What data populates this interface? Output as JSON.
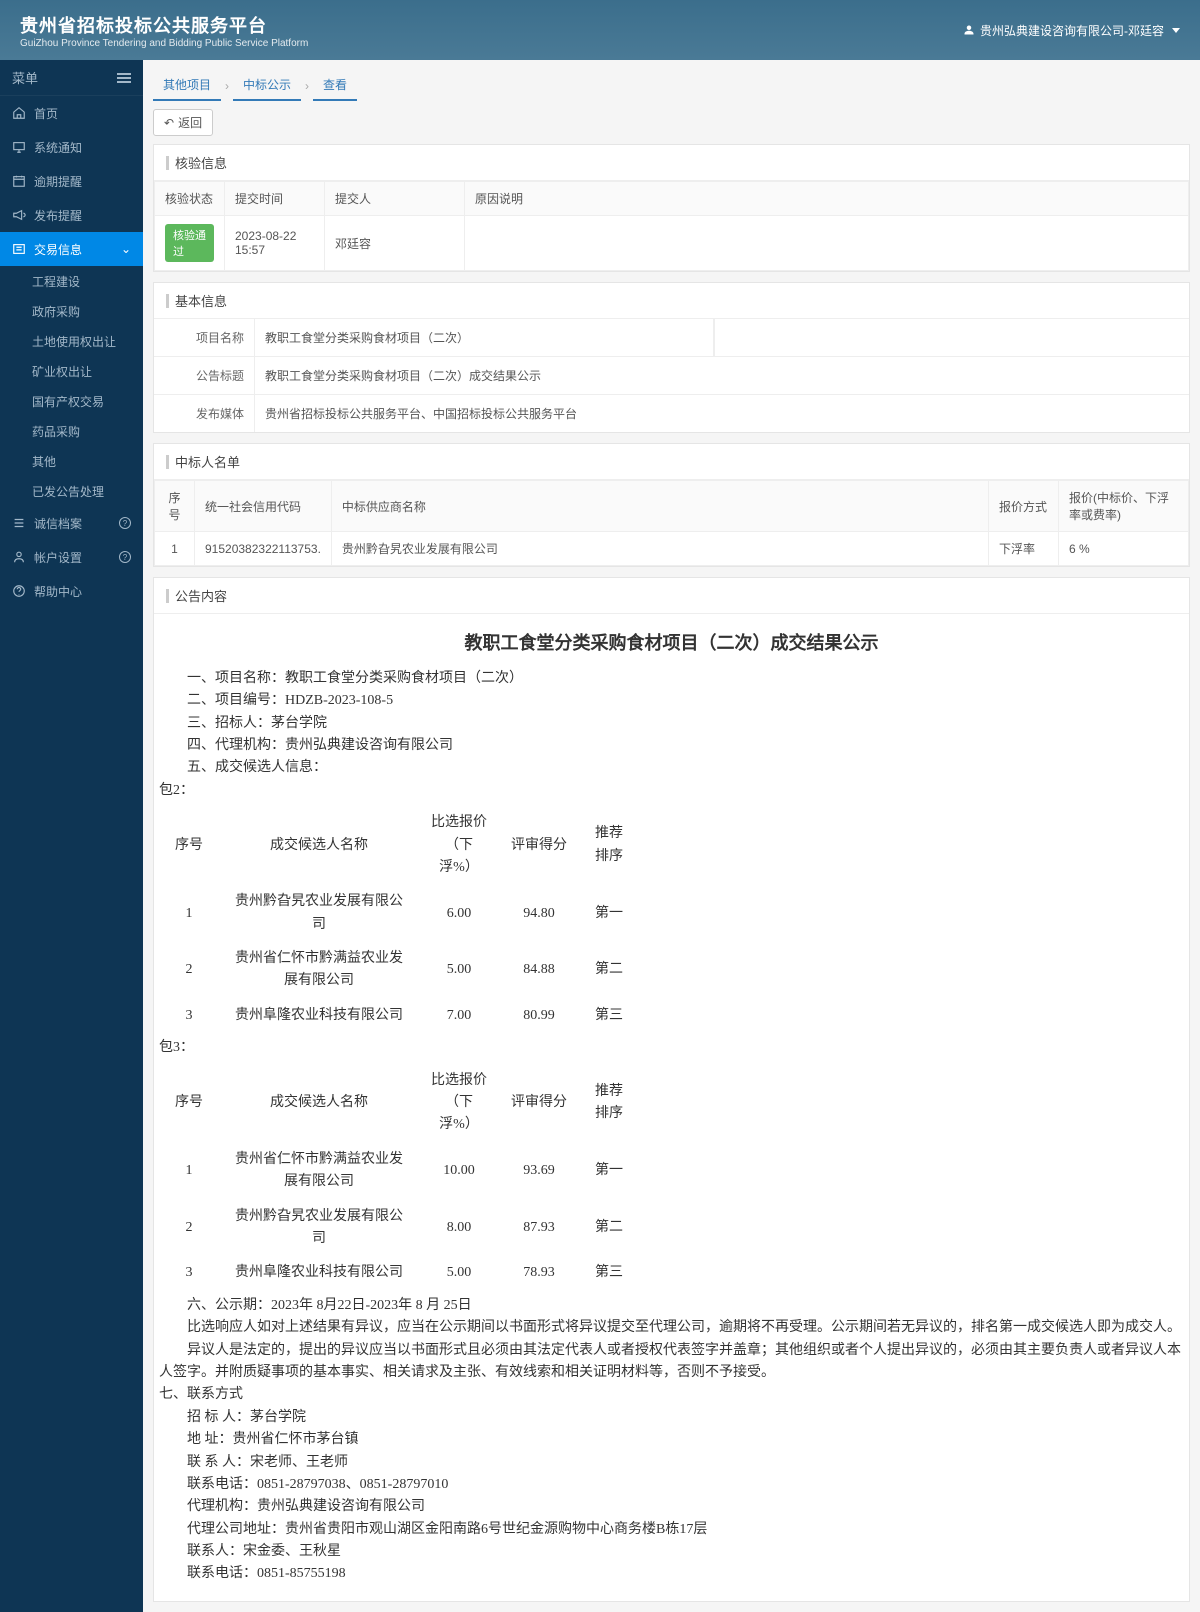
{
  "header": {
    "title": "贵州省招标投标公共服务平台",
    "subtitle": "GuiZhou Province Tendering and Bidding Public Service Platform",
    "user": "贵州弘典建设咨询有限公司-邓廷容"
  },
  "sidebar": {
    "menu_label": "菜单",
    "items": [
      {
        "icon": "home",
        "label": "首页"
      },
      {
        "icon": "monitor",
        "label": "系统通知"
      },
      {
        "icon": "calendar",
        "label": "逾期提醒"
      },
      {
        "icon": "megaphone",
        "label": "发布提醒"
      },
      {
        "icon": "folder",
        "label": "交易信息",
        "active": true,
        "expand": true
      }
    ],
    "sub_items": [
      "工程建设",
      "政府采购",
      "土地使用权出让",
      "矿业权出让",
      "国有产权交易",
      "药品采购",
      "其他",
      "已发公告处理"
    ],
    "tail_items": [
      {
        "icon": "list",
        "label": "诚信档案",
        "badge": true
      },
      {
        "icon": "user",
        "label": "帐户设置",
        "badge": true
      },
      {
        "icon": "help",
        "label": "帮助中心"
      }
    ]
  },
  "breadcrumb": {
    "items": [
      "其他项目",
      "中标公示",
      "查看"
    ]
  },
  "back_label": "返回",
  "verify_panel": {
    "title": "核验信息",
    "headers": [
      "核验状态",
      "提交时间",
      "提交人",
      "原因说明"
    ],
    "row": {
      "status": "核验通过",
      "time": "2023-08-22 15:57",
      "submitter": "邓廷容",
      "reason": ""
    }
  },
  "basic_panel": {
    "title": "基本信息",
    "rows": [
      {
        "label": "项目名称",
        "value": "教职工食堂分类采购食材项目（二次）",
        "boxed": true
      },
      {
        "label": "公告标题",
        "value": "教职工食堂分类采购食材项目（二次）成交结果公示"
      },
      {
        "label": "发布媒体",
        "value": "贵州省招标投标公共服务平台、中国招标投标公共服务平台"
      }
    ]
  },
  "winner_panel": {
    "title": "中标人名单",
    "headers": [
      "序号",
      "统一社会信用代码",
      "中标供应商名称",
      "报价方式",
      "报价(中标价、下浮率或费率)"
    ],
    "rows": [
      {
        "seq": "1",
        "code": "91520382322113753.",
        "name": "贵州黔旮旯农业发展有限公司",
        "method": "下浮率",
        "price": "6 %"
      }
    ]
  },
  "content_panel": {
    "title": "公告内容",
    "announcement_title": "教职工食堂分类采购食材项目（二次）成交结果公示",
    "lines1": [
      "一、项目名称：教职工食堂分类采购食材项目（二次）",
      "二、项目编号：HDZB-2023-108-5",
      "三、招标人：茅台学院",
      "四、代理机构：贵州弘典建设咨询有限公司",
      "五、成交候选人信息："
    ],
    "pkg2_label": "包2：",
    "pkg3_label": "包3：",
    "table_headers": [
      "序号",
      "成交候选人名称",
      "比选报价（下浮%）",
      "评审得分",
      "推荐排序"
    ],
    "pkg2_rows": [
      {
        "n": "1",
        "name": "贵州黔旮旯农业发展有限公司",
        "price": "6.00",
        "score": "94.80",
        "rank": "第一"
      },
      {
        "n": "2",
        "name": "贵州省仁怀市黔满益农业发展有限公司",
        "price": "5.00",
        "score": "84.88",
        "rank": "第二"
      },
      {
        "n": "3",
        "name": "贵州阜隆农业科技有限公司",
        "price": "7.00",
        "score": "80.99",
        "rank": "第三"
      }
    ],
    "pkg3_rows": [
      {
        "n": "1",
        "name": "贵州省仁怀市黔满益农业发展有限公司",
        "price": "10.00",
        "score": "93.69",
        "rank": "第一"
      },
      {
        "n": "2",
        "name": "贵州黔旮旯农业发展有限公司",
        "price": "8.00",
        "score": "87.93",
        "rank": "第二"
      },
      {
        "n": "3",
        "name": "贵州阜隆农业科技有限公司",
        "price": "5.00",
        "score": "78.93",
        "rank": "第三"
      }
    ],
    "lines2": [
      "六、公示期：2023年  8月22日-2023年  8 月  25日"
    ],
    "para1": "比选响应人如对上述结果有异议，应当在公示期间以书面形式将异议提交至代理公司，逾期将不再受理。公示期间若无异议的，排名第一成交候选人即为成交人。",
    "para2": "异议人是法定的，提出的异议应当以书面形式且必须由其法定代表人或者授权代表签字并盖章；其他组织或者个人提出异议的，必须由其主要负责人或者异议人本人签字。并附质疑事项的基本事实、相关请求及主张、有效线索和相关证明材料等，否则不予接受。",
    "contact_header": "七、联系方式",
    "contact_lines": [
      "招   标   人：茅台学院",
      "地         址：贵州省仁怀市茅台镇",
      "联   系   人：宋老师、王老师",
      "联系电话：0851-28797038、0851-28797010",
      "代理机构：贵州弘典建设咨询有限公司",
      "代理公司地址：贵州省贵阳市观山湖区金阳南路6号世纪金源购物中心商务楼B栋17层",
      "联系人：宋金委、王秋星",
      "联系电话：0851-85755198"
    ]
  }
}
